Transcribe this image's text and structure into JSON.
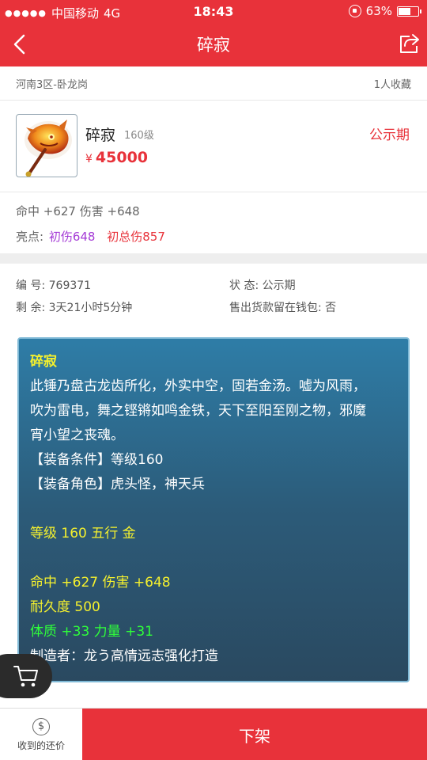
{
  "status_bar": {
    "signal_dots": "●●●●●",
    "carrier": "中国移动",
    "network": "4G",
    "time": "18:43",
    "battery": "63%",
    "battery_level": 0.63
  },
  "nav": {
    "title": "碎寂",
    "back_icon": "chevron-left-icon",
    "share_icon": "share-icon"
  },
  "listing": {
    "region": "河南3区-卧龙岗",
    "favorites": "1人收藏",
    "item_name": "碎寂",
    "item_level": "160级",
    "price_currency": "¥",
    "price": "45000",
    "status": "公示期",
    "attributes": "命中 +627 伤害 +648",
    "highlights_label": "亮点:",
    "highlight_1": "初伤648",
    "highlight_2": "初总伤857"
  },
  "info": {
    "serial_label": "编 号:",
    "serial_value": "769371",
    "state_label": "状 态:",
    "state_value": "公示期",
    "remaining_label": "剩 余:",
    "remaining_value": "3天21小时5分钟",
    "wallet_label": "售出货款留在钱包:",
    "wallet_value": "否"
  },
  "description": {
    "title": "碎寂",
    "line1": "此锤乃盘古龙齿所化，外实中空，固若金汤。嘘为风雨，",
    "line2": "吹为雷电，舞之铿锵如鸣金铁，天下至阳至刚之物，邪魔",
    "line3": "宵小望之丧魂。",
    "line4": "【装备条件】等级160",
    "line5": "【装备角色】虎头怪，神天兵",
    "line6": "等级 160  五行 金",
    "line7": "命中 +627 伤害 +648",
    "line8": "耐久度 500",
    "line9": "体质 +33 力量 +31",
    "line10": "制造者：龙う高情远志强化打造"
  },
  "bottom": {
    "offer_label": "收到的还价",
    "offer_icon": "dollar-coin-icon",
    "delist_label": "下架",
    "cart_icon": "cart-icon"
  },
  "colors": {
    "brand_red": "#e8323a",
    "desc_yellow": "#f4f02e",
    "desc_green": "#2fff3a",
    "highlight_purple": "#a43ad6"
  }
}
